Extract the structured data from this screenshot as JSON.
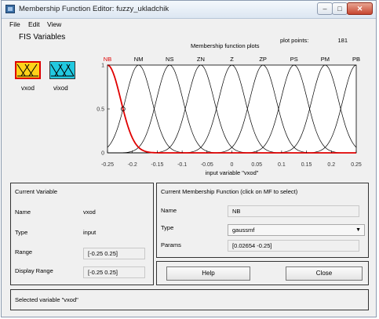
{
  "window": {
    "title": "Membership Function Editor: fuzzy_ukladchik"
  },
  "menu": [
    "File",
    "Edit",
    "View"
  ],
  "fis": {
    "title": "FIS Variables",
    "variables": [
      {
        "label": "vxod",
        "kind": "input",
        "selected": true,
        "color": "#ffd21a"
      },
      {
        "label": "vixod",
        "kind": "output",
        "selected": false,
        "color": "#22c9e0"
      }
    ]
  },
  "plot": {
    "title": "Membership function plots",
    "plot_points_label": "plot points:",
    "plot_points_value": "181",
    "xlabel": "input variable \"vxod\"",
    "ytick_labels": [
      "1",
      "0.5",
      "0"
    ]
  },
  "chart_data": {
    "type": "line",
    "title": "Membership function plots",
    "xlabel": "input variable \"vxod\"",
    "ylabel": "",
    "xlim": [
      -0.25,
      0.25
    ],
    "ylim": [
      0,
      1
    ],
    "grid": false,
    "x_ticks": [
      -0.25,
      -0.2,
      -0.15,
      -0.1,
      -0.05,
      0,
      0.05,
      0.1,
      0.15,
      0.2,
      0.25
    ],
    "x_tick_labels": [
      "-0.25",
      "-0.2",
      "-0.15",
      "-0.1",
      "-0.05",
      "0",
      "0.05",
      "0.1",
      "0.15",
      "0.2",
      "0.25"
    ],
    "y_ticks": [
      0,
      0.5,
      1
    ],
    "y_tick_labels": [
      "0",
      "0.5",
      "1"
    ],
    "mf_type": "gaussmf",
    "sigma": 0.02654,
    "series": [
      {
        "name": "NB",
        "center": -0.25,
        "highlighted": true
      },
      {
        "name": "NM",
        "center": -0.1875
      },
      {
        "name": "NS",
        "center": -0.125
      },
      {
        "name": "ZN",
        "center": -0.0625
      },
      {
        "name": "Z",
        "center": 0
      },
      {
        "name": "ZP",
        "center": 0.0625
      },
      {
        "name": "PS",
        "center": 0.125
      },
      {
        "name": "PM",
        "center": 0.1875
      },
      {
        "name": "PB",
        "center": 0.25
      }
    ],
    "colors": {
      "highlight": "#e00000",
      "normal": "#000000"
    }
  },
  "current_variable": {
    "title": "Current Variable",
    "name_label": "Name",
    "name_value": "vxod",
    "type_label": "Type",
    "type_value": "input",
    "range_label": "Range",
    "range_value": "[-0.25 0.25]",
    "display_range_label": "Display Range",
    "display_range_value": "[-0.25 0.25]"
  },
  "current_mf": {
    "title": "Current Membership Function (click on MF to select)",
    "name_label": "Name",
    "name_value": "NB",
    "type_label": "Type",
    "type_value": "gaussmf",
    "params_label": "Params",
    "params_value": "[0.02654 -0.25]"
  },
  "buttons": {
    "help": "Help",
    "close": "Close"
  },
  "status": "Selected variable \"vxod\""
}
